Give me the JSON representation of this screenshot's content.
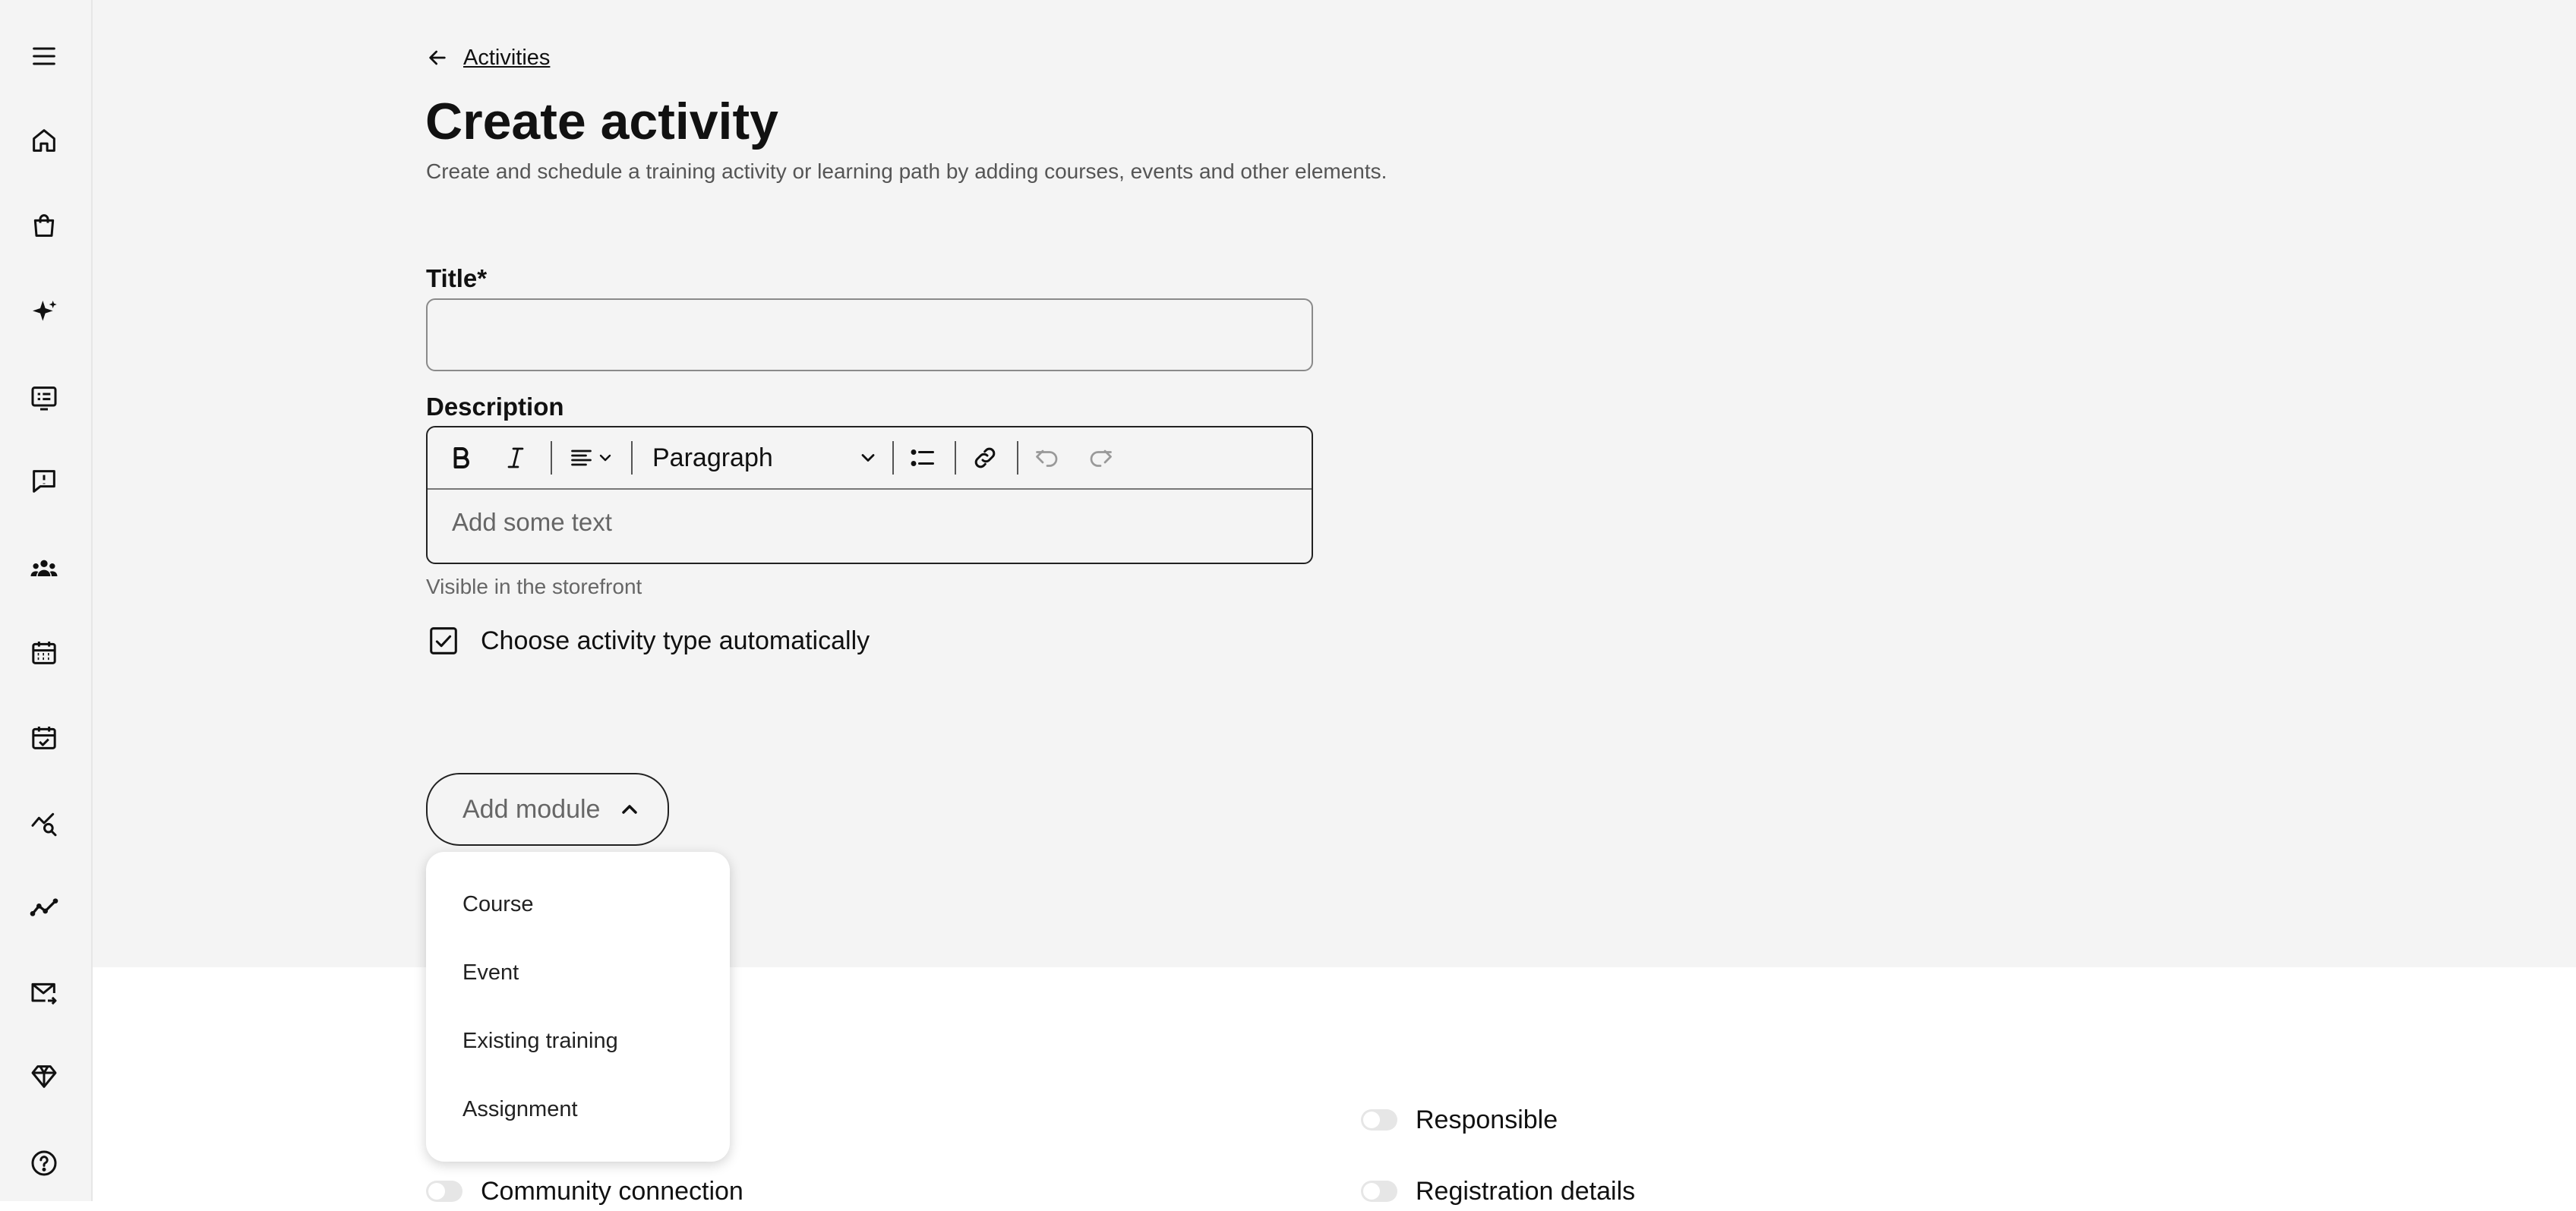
{
  "header": {
    "back_label": "Activities",
    "title": "Create activity",
    "subtitle": "Create and schedule a training activity or learning path by adding courses, events and other elements."
  },
  "sidebar": {
    "items": [
      {
        "icon": "menu-icon"
      },
      {
        "icon": "home-icon"
      },
      {
        "icon": "shopping-bag-icon"
      },
      {
        "icon": "sparkles-icon"
      },
      {
        "icon": "course-list-icon"
      },
      {
        "icon": "feedback-icon"
      },
      {
        "icon": "users-icon"
      },
      {
        "icon": "calendar-icon"
      },
      {
        "icon": "calendar-check-icon"
      },
      {
        "icon": "analytics-search-icon"
      },
      {
        "icon": "trend-line-icon"
      },
      {
        "icon": "mail-forward-icon"
      },
      {
        "icon": "diamond-icon"
      },
      {
        "icon": "help-icon"
      }
    ]
  },
  "form": {
    "title_label": "Title",
    "required_mark": "*",
    "title_value": "",
    "description_label": "Description",
    "editor": {
      "paragraph_select": "Paragraph",
      "placeholder": "Add some text"
    },
    "description_helper": "Visible in the storefront",
    "auto_type_checkbox": {
      "label": "Choose activity type automatically",
      "checked": true
    }
  },
  "add_module": {
    "label": "Add module",
    "options": [
      "Course",
      "Event",
      "Existing training",
      "Assignment"
    ]
  },
  "toggles": [
    {
      "label": "Responsible",
      "on": false
    },
    {
      "label": "Community connection",
      "on": false
    },
    {
      "label": "Registration details",
      "on": false
    }
  ]
}
